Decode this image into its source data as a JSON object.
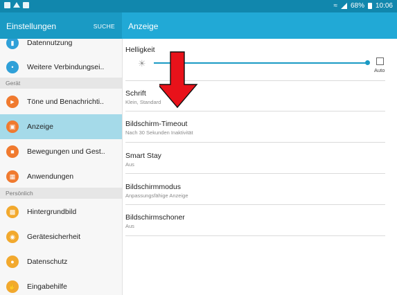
{
  "status_bar": {
    "battery": "68%",
    "time": "10:06"
  },
  "sidebar": {
    "header_title": "Einstellungen",
    "search_label": "SUCHE",
    "items_top": [
      {
        "label": "Datennutzung",
        "color": "#2fa0d8"
      },
      {
        "label": "Weitere Verbindungsei..",
        "color": "#2fa0d8"
      }
    ],
    "section_device": "Gerät",
    "items_device": [
      {
        "label": "Töne und Benachrichti..",
        "color": "#f07a2f"
      },
      {
        "label": "Anzeige",
        "color": "#f07a2f"
      },
      {
        "label": "Bewegungen und Gest..",
        "color": "#f07a2f"
      },
      {
        "label": "Anwendungen",
        "color": "#f07a2f"
      }
    ],
    "section_personal": "Persönlich",
    "items_personal": [
      {
        "label": "Hintergrundbild",
        "color": "#f2a92e"
      },
      {
        "label": "Gerätesicherheit",
        "color": "#f2a92e"
      },
      {
        "label": "Datenschutz",
        "color": "#f2a92e"
      },
      {
        "label": "Eingabehilfe",
        "color": "#f2a92e"
      }
    ]
  },
  "content": {
    "header_title": "Anzeige",
    "brightness": {
      "title": "Helligkeit",
      "auto_label": "Auto",
      "level_fraction": 0.98,
      "auto_checked": false
    },
    "rows": [
      {
        "title": "Schrift",
        "subtitle": "Klein, Standard"
      },
      {
        "title": "Bildschirm-Timeout",
        "subtitle": "Nach 30 Sekunden Inaktivität"
      },
      {
        "title": "Smart Stay",
        "subtitle": "Aus"
      },
      {
        "title": "Bildschirmmodus",
        "subtitle": "Anpassungsfähige Anzeige"
      },
      {
        "title": "Bildschirmschoner",
        "subtitle": "Aus"
      }
    ]
  },
  "colors": {
    "status_bar": "#1187ad",
    "header_left": "#1a9ac4",
    "header_right": "#21a9d6",
    "active_item": "#a5dae9",
    "arrow": "#e8121a"
  }
}
